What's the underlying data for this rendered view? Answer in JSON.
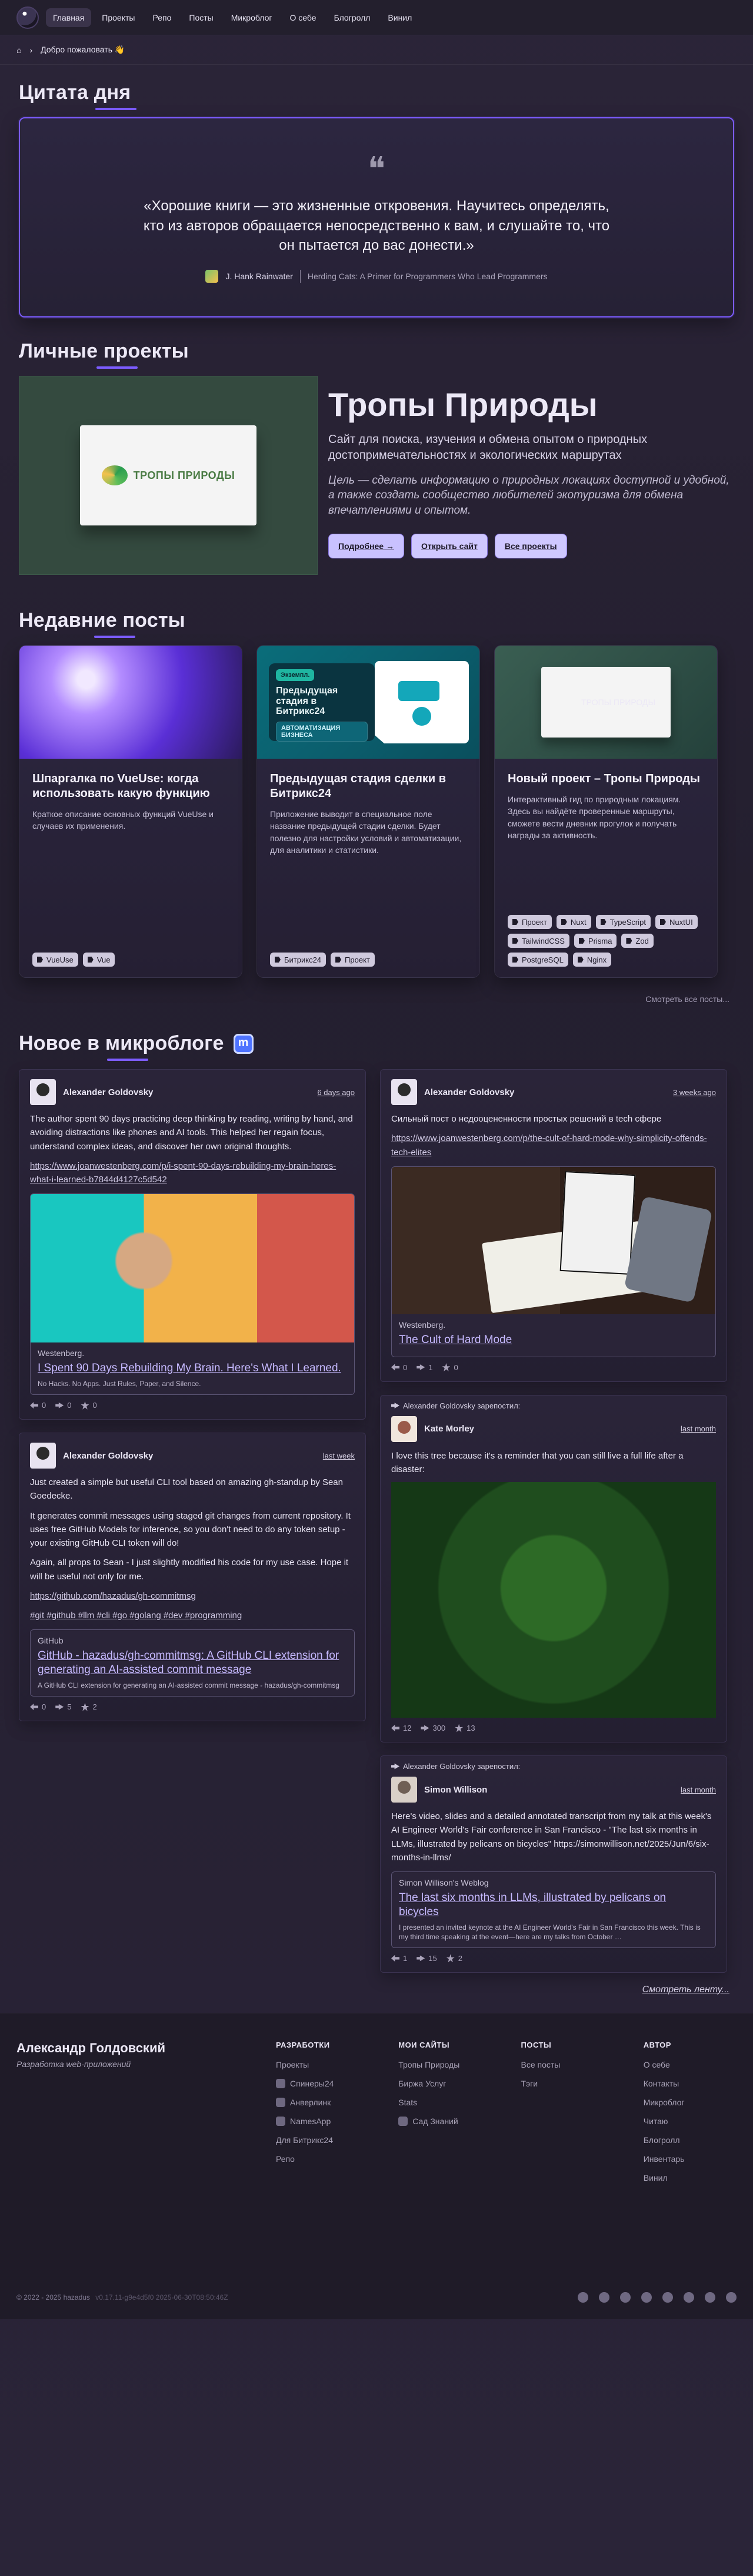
{
  "topbar": {
    "nav": [
      {
        "label": "Главная",
        "active": true
      },
      {
        "label": "Проекты"
      },
      {
        "label": "Репо"
      },
      {
        "label": "Посты"
      },
      {
        "label": "Микроблог"
      },
      {
        "label": "О себе"
      },
      {
        "label": "Блогролл"
      },
      {
        "label": "Винил"
      }
    ]
  },
  "breadcrumb": {
    "label": "Добро пожаловать 👋"
  },
  "quote": {
    "section_title": "Цитата дня",
    "mark": "❝",
    "text": "«Хорошие книги — это жизненные откровения. Научитесь определять, кто из авторов обращается непосредственно к вам, и слушайте то, что он пытается до вас донести.»",
    "author": "J. Hank Rainwater",
    "book": "Herding Cats: A Primer for Programmers Who Lead Programmers"
  },
  "projects": {
    "section_title": "Личные проекты",
    "featured": {
      "title": "Тропы Природы",
      "desc": "Сайт для поиска, изучения и обмена опытом о природных достопримечательностях и экологических маршрутах",
      "goal": "Цель — сделать информацию о природных локациях доступной и удобной, а также создать сообщество любителей экотуризма для обмена впечатлениями и опытом.",
      "buttons": {
        "more": "Подробнее →",
        "open": "Открыть сайт",
        "all": "Все проекты"
      },
      "logo_text": "ТРОПЫ ПРИРОДЫ"
    }
  },
  "recent_posts": {
    "section_title": "Недавние посты",
    "cards": [
      {
        "title": "Шпаргалка по VueUse: когда использовать какую функцию",
        "excerpt": "Краткое описание основных функций VueUse и случаев их применения.",
        "tags": [
          "VueUse",
          "Vue"
        ]
      },
      {
        "title": "Предыдущая стадия сделки в Битрикс24",
        "excerpt": "Приложение выводит в специальное поле название предыдущей стадии сделки. Будет полезно для настройки условий и автоматизации, для аналитики и статистики.",
        "tags": [
          "Битрикс24",
          "Проект"
        ],
        "image": {
          "pill": "Экземпл.",
          "title": "Предыдущая стадия в Битрикс24",
          "pill2": "АВТОМАТИЗАЦИЯ БИЗНЕСА"
        }
      },
      {
        "title": "Новый проект – Тропы Природы",
        "excerpt": "Интерактивный гид по природным локациям. Здесь вы найдёте проверенные маршруты, сможете вести дневник прогулок и получать награды за активность.",
        "tags": [
          "Проект",
          "Nuxt",
          "TypeScript",
          "NuxtUI",
          "TailwindCSS",
          "Prisma",
          "Zod",
          "PostgreSQL",
          "Nginx"
        ],
        "logo_text": "ТРОПЫ ПРИРОДЫ"
      }
    ],
    "view_all": "Смотреть все посты..."
  },
  "micro": {
    "section_title": "Новое в микроблоге",
    "left": [
      {
        "name": "Alexander Goldovsky",
        "time": "6 days ago",
        "text": [
          "The author spent 90 days practicing deep thinking by reading, writing by hand, and avoiding distractions like phones and AI tools. This helped her regain focus, understand complex ideas, and discover her own original thoughts.",
          "https://www.joanwestenberg.com/p/i-spent-90-days-rebuilding-my-brain-heres-what-i-learned-b7844d4127c5d542"
        ],
        "preview": {
          "site": "Westenberg.",
          "title": "I Spent 90 Days Rebuilding My Brain. Here's What I Learned.",
          "desc": "No Hacks. No Apps. Just Rules, Paper, and Silence."
        },
        "actions": [
          "0",
          "0",
          "0"
        ]
      },
      {
        "name": "Alexander Goldovsky",
        "time": "last week",
        "text": [
          "Just created a simple but useful CLI tool based on amazing gh-standup by Sean Goedecke.",
          "It generates commit messages using staged git changes from current repository. It uses free GitHub Models for inference, so you don't need to do any token setup - your existing GitHub CLI token will do!",
          "Again, all props to Sean - I just slightly modified his code for my use case. Hope it will be useful not only for me.",
          "https://github.com/hazadus/gh-commitmsg",
          "#git #github #llm #cli #go #golang #dev #programming"
        ],
        "preview": {
          "site": "GitHub",
          "title": "GitHub - hazadus/gh-commitmsg: A GitHub CLI extension for generating an AI-assisted commit message",
          "desc": "A GitHub CLI extension for generating an AI-assisted commit message - hazadus/gh-commitmsg"
        },
        "actions": [
          "0",
          "5",
          "2"
        ]
      }
    ],
    "right": [
      {
        "name": "Alexander Goldovsky",
        "time": "3 weeks ago",
        "text": [
          "Сильный пост о недооцененности простых решений в tech сфере",
          "https://www.joanwestenberg.com/p/the-cult-of-hard-mode-why-simplicity-offends-tech-elites"
        ],
        "preview": {
          "site": "Westenberg.",
          "title": "The Cult of Hard Mode",
          "desc": ""
        },
        "actions": [
          "0",
          "1",
          "0"
        ]
      },
      {
        "reblog": "Alexander Goldovsky зарепостил:",
        "name": "Kate Morley",
        "time": "last month",
        "text": [
          "I love this tree because it's a reminder that you can still live a full life after a disaster:"
        ],
        "actions": [
          "12",
          "300",
          "13"
        ]
      },
      {
        "reblog": "Alexander Goldovsky зарепостил:",
        "name": "Simon Willison",
        "time": "last month",
        "text": [
          "Here's video, slides and a detailed annotated transcript from my talk at this week's AI Engineer World's Fair conference in San Francisco - \"The last six months in LLMs, illustrated by pelicans on bicycles\" https://simonwillison.net/2025/Jun/6/six-months-in-llms/"
        ],
        "preview": {
          "site": "Simon Willison's Weblog",
          "title": "The last six months in LLMs, illustrated by pelicans on bicycles",
          "desc": "I presented an invited keynote at the AI Engineer World's Fair in San Francisco this week. This is my third time speaking at the event—here are my talks from October …"
        },
        "actions": [
          "1",
          "15",
          "2"
        ]
      }
    ],
    "more": "Смотреть ленту..."
  },
  "footer": {
    "name": "Александр Голдовский",
    "subtitle": "Разработка web-приложений",
    "cols": [
      {
        "h": "РАЗРАБОТКИ",
        "items": [
          "Проекты",
          "Спинеры24",
          "Анверлинк",
          "NamesApp",
          "Для Битрикс24",
          "Репо"
        ]
      },
      {
        "h": "МОИ САЙТЫ",
        "items": [
          "Тропы Природы",
          "Биржа Услуг",
          "Stats",
          "Сад Знаний"
        ]
      },
      {
        "h": "ПОСТЫ",
        "items": [
          "Все посты",
          "Тэги"
        ]
      },
      {
        "h": "АВТОР",
        "items": [
          "О себе",
          "Контакты",
          "Микроблог",
          "Читаю",
          "Блогролл",
          "Инвентарь",
          "Винил"
        ]
      }
    ],
    "copyright": "© 2022 - 2025 hazadus",
    "version": "v0.17.11-g9e4d5f0 2025-06-30T08:50:46Z"
  }
}
